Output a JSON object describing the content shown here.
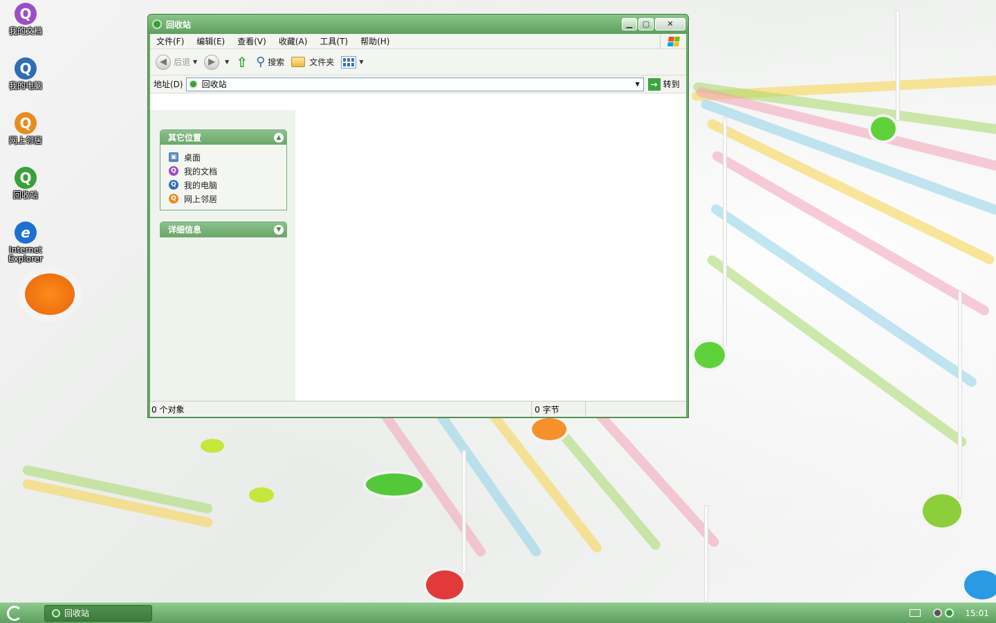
{
  "desktop": {
    "icons": [
      {
        "label": "我的文档",
        "color": "#9b4fc6"
      },
      {
        "label": "我的电脑",
        "color": "#2f6db5"
      },
      {
        "label": "网上邻居",
        "color": "#e98b1f"
      },
      {
        "label": "回收站",
        "color": "#3aa13a"
      },
      {
        "label": "Internet Explorer",
        "color": "#1d6fd1"
      }
    ]
  },
  "window": {
    "title": "回收站",
    "menu": [
      "文件(F)",
      "编辑(E)",
      "查看(V)",
      "收藏(A)",
      "工具(T)",
      "帮助(H)"
    ],
    "toolbar": {
      "back": "后退",
      "search": "搜索",
      "folders": "文件夹"
    },
    "address": {
      "label": "地址(D)",
      "value": "回收站",
      "go": "转到"
    },
    "taskpane": {
      "other_places": {
        "title": "其它位置",
        "items": [
          {
            "label": "桌面",
            "color": "#5b86c4"
          },
          {
            "label": "我的文档",
            "color": "#9b4fc6"
          },
          {
            "label": "我的电脑",
            "color": "#2f6db5"
          },
          {
            "label": "网上邻居",
            "color": "#e98b1f"
          }
        ]
      },
      "details": {
        "title": "详细信息"
      }
    },
    "status": {
      "objects": "0 个对象",
      "bytes": "0 字节"
    }
  },
  "taskbar": {
    "task": "回收站",
    "clock": "15:01"
  }
}
